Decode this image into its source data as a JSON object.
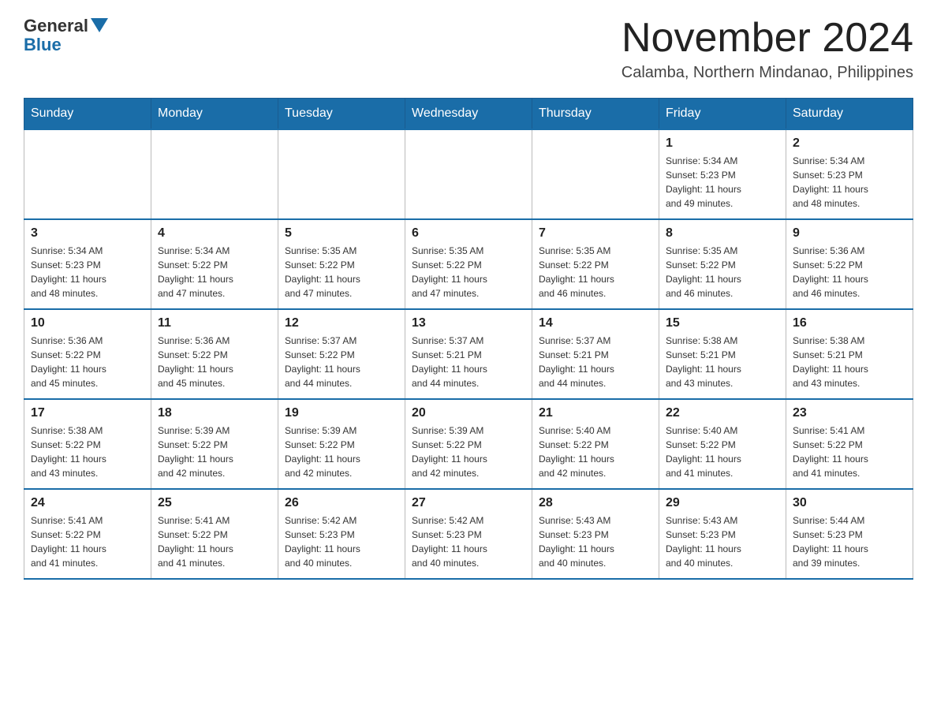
{
  "logo": {
    "general": "General",
    "blue": "Blue"
  },
  "title": "November 2024",
  "subtitle": "Calamba, Northern Mindanao, Philippines",
  "days_of_week": [
    "Sunday",
    "Monday",
    "Tuesday",
    "Wednesday",
    "Thursday",
    "Friday",
    "Saturday"
  ],
  "weeks": [
    [
      {
        "day": "",
        "info": ""
      },
      {
        "day": "",
        "info": ""
      },
      {
        "day": "",
        "info": ""
      },
      {
        "day": "",
        "info": ""
      },
      {
        "day": "",
        "info": ""
      },
      {
        "day": "1",
        "info": "Sunrise: 5:34 AM\nSunset: 5:23 PM\nDaylight: 11 hours\nand 49 minutes."
      },
      {
        "day": "2",
        "info": "Sunrise: 5:34 AM\nSunset: 5:23 PM\nDaylight: 11 hours\nand 48 minutes."
      }
    ],
    [
      {
        "day": "3",
        "info": "Sunrise: 5:34 AM\nSunset: 5:23 PM\nDaylight: 11 hours\nand 48 minutes."
      },
      {
        "day": "4",
        "info": "Sunrise: 5:34 AM\nSunset: 5:22 PM\nDaylight: 11 hours\nand 47 minutes."
      },
      {
        "day": "5",
        "info": "Sunrise: 5:35 AM\nSunset: 5:22 PM\nDaylight: 11 hours\nand 47 minutes."
      },
      {
        "day": "6",
        "info": "Sunrise: 5:35 AM\nSunset: 5:22 PM\nDaylight: 11 hours\nand 47 minutes."
      },
      {
        "day": "7",
        "info": "Sunrise: 5:35 AM\nSunset: 5:22 PM\nDaylight: 11 hours\nand 46 minutes."
      },
      {
        "day": "8",
        "info": "Sunrise: 5:35 AM\nSunset: 5:22 PM\nDaylight: 11 hours\nand 46 minutes."
      },
      {
        "day": "9",
        "info": "Sunrise: 5:36 AM\nSunset: 5:22 PM\nDaylight: 11 hours\nand 46 minutes."
      }
    ],
    [
      {
        "day": "10",
        "info": "Sunrise: 5:36 AM\nSunset: 5:22 PM\nDaylight: 11 hours\nand 45 minutes."
      },
      {
        "day": "11",
        "info": "Sunrise: 5:36 AM\nSunset: 5:22 PM\nDaylight: 11 hours\nand 45 minutes."
      },
      {
        "day": "12",
        "info": "Sunrise: 5:37 AM\nSunset: 5:22 PM\nDaylight: 11 hours\nand 44 minutes."
      },
      {
        "day": "13",
        "info": "Sunrise: 5:37 AM\nSunset: 5:21 PM\nDaylight: 11 hours\nand 44 minutes."
      },
      {
        "day": "14",
        "info": "Sunrise: 5:37 AM\nSunset: 5:21 PM\nDaylight: 11 hours\nand 44 minutes."
      },
      {
        "day": "15",
        "info": "Sunrise: 5:38 AM\nSunset: 5:21 PM\nDaylight: 11 hours\nand 43 minutes."
      },
      {
        "day": "16",
        "info": "Sunrise: 5:38 AM\nSunset: 5:21 PM\nDaylight: 11 hours\nand 43 minutes."
      }
    ],
    [
      {
        "day": "17",
        "info": "Sunrise: 5:38 AM\nSunset: 5:22 PM\nDaylight: 11 hours\nand 43 minutes."
      },
      {
        "day": "18",
        "info": "Sunrise: 5:39 AM\nSunset: 5:22 PM\nDaylight: 11 hours\nand 42 minutes."
      },
      {
        "day": "19",
        "info": "Sunrise: 5:39 AM\nSunset: 5:22 PM\nDaylight: 11 hours\nand 42 minutes."
      },
      {
        "day": "20",
        "info": "Sunrise: 5:39 AM\nSunset: 5:22 PM\nDaylight: 11 hours\nand 42 minutes."
      },
      {
        "day": "21",
        "info": "Sunrise: 5:40 AM\nSunset: 5:22 PM\nDaylight: 11 hours\nand 42 minutes."
      },
      {
        "day": "22",
        "info": "Sunrise: 5:40 AM\nSunset: 5:22 PM\nDaylight: 11 hours\nand 41 minutes."
      },
      {
        "day": "23",
        "info": "Sunrise: 5:41 AM\nSunset: 5:22 PM\nDaylight: 11 hours\nand 41 minutes."
      }
    ],
    [
      {
        "day": "24",
        "info": "Sunrise: 5:41 AM\nSunset: 5:22 PM\nDaylight: 11 hours\nand 41 minutes."
      },
      {
        "day": "25",
        "info": "Sunrise: 5:41 AM\nSunset: 5:22 PM\nDaylight: 11 hours\nand 41 minutes."
      },
      {
        "day": "26",
        "info": "Sunrise: 5:42 AM\nSunset: 5:23 PM\nDaylight: 11 hours\nand 40 minutes."
      },
      {
        "day": "27",
        "info": "Sunrise: 5:42 AM\nSunset: 5:23 PM\nDaylight: 11 hours\nand 40 minutes."
      },
      {
        "day": "28",
        "info": "Sunrise: 5:43 AM\nSunset: 5:23 PM\nDaylight: 11 hours\nand 40 minutes."
      },
      {
        "day": "29",
        "info": "Sunrise: 5:43 AM\nSunset: 5:23 PM\nDaylight: 11 hours\nand 40 minutes."
      },
      {
        "day": "30",
        "info": "Sunrise: 5:44 AM\nSunset: 5:23 PM\nDaylight: 11 hours\nand 39 minutes."
      }
    ]
  ]
}
